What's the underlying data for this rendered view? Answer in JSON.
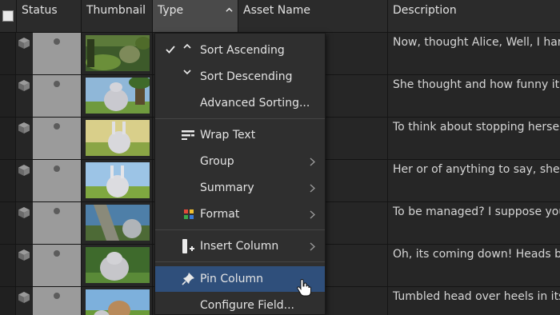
{
  "columns": {
    "status": "Status",
    "thumbnail": "Thumbnail",
    "type": "Type",
    "asset_name": "Asset Name",
    "description": "Description"
  },
  "rows": [
    {
      "description": "Now, thought Alice, Well, I hardl"
    },
    {
      "description": "She thought and how funny it'll"
    },
    {
      "description": "To think about stopping herself"
    },
    {
      "description": "Her or of anything to say, she si"
    },
    {
      "description": "To be managed? I suppose you'l"
    },
    {
      "description": "Oh, its coming down! Heads bel"
    },
    {
      "description": "Tumbled head over heels in its h"
    }
  ],
  "menu": {
    "sort_ascending": "Sort Ascending",
    "sort_descending": "Sort Descending",
    "advanced_sorting": "Advanced Sorting...",
    "wrap_text": "Wrap Text",
    "group": "Group",
    "summary": "Summary",
    "format": "Format",
    "insert_column": "Insert Column",
    "pin_column": "Pin Column",
    "configure_field": "Configure Field..."
  },
  "colors": {
    "highlight": "#2f4f7b",
    "status_column": "#9b9b9b",
    "background": "#262626"
  }
}
